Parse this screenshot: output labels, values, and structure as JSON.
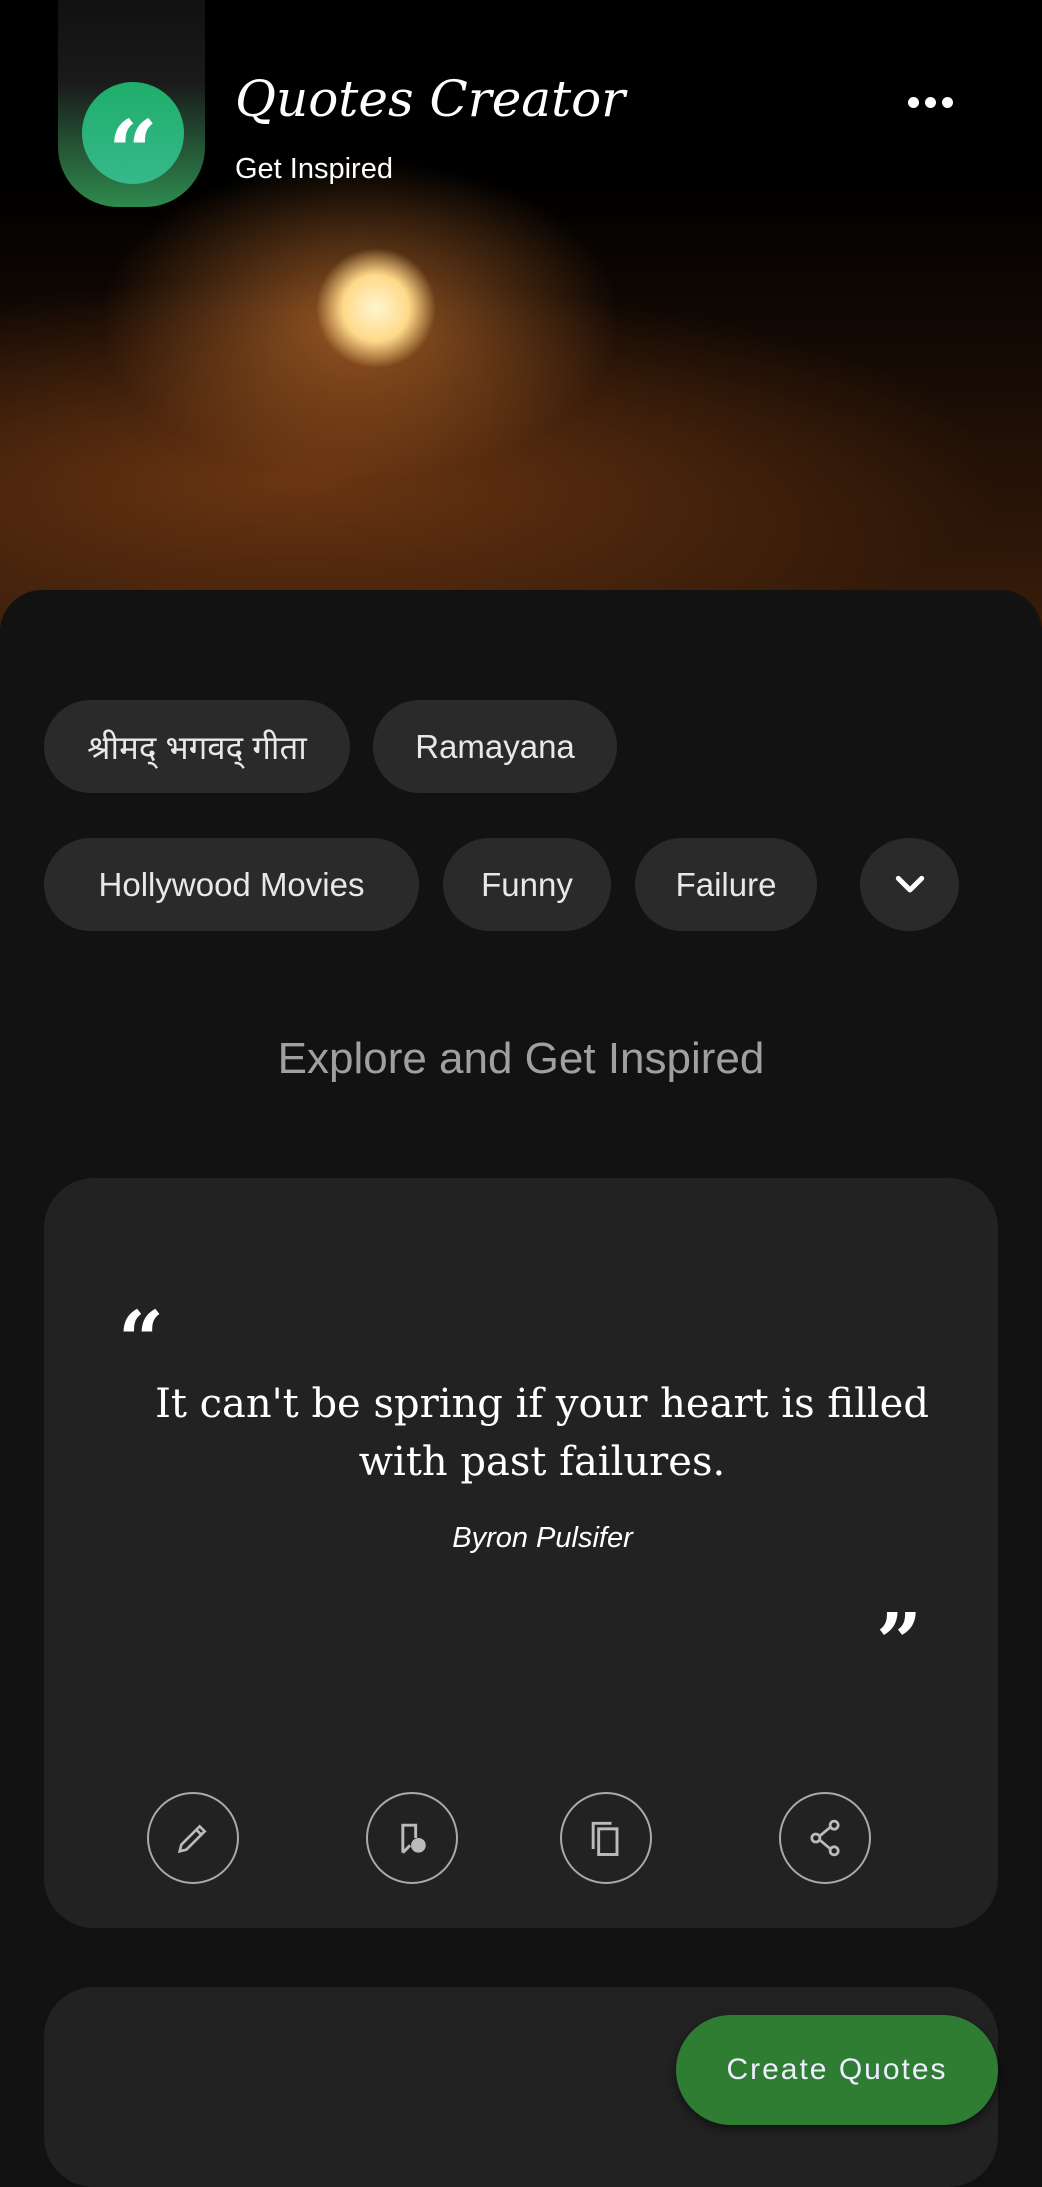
{
  "header": {
    "title": "Quotes Creator",
    "subtitle": "Get Inspired",
    "logo_icon": "quote-icon",
    "menu_icon": "more-horizontal-icon",
    "accent": "#2db380"
  },
  "categories": [
    {
      "label": "श्रीमद् भगवद् गीता"
    },
    {
      "label": "Ramayana"
    },
    {
      "label": "Hollywood Movies"
    },
    {
      "label": "Funny"
    },
    {
      "label": "Failure"
    }
  ],
  "expand_icon": "chevron-down-icon",
  "section_title": "Explore and Get Inspired",
  "quote": {
    "open_mark": "“",
    "close_mark": "”",
    "text": "It can't be spring if your heart is filled with past failures.",
    "author": "Byron Pulsifer",
    "actions": [
      {
        "icon": "edit-icon"
      },
      {
        "icon": "bookmark-add-icon"
      },
      {
        "icon": "copy-icon"
      },
      {
        "icon": "share-icon"
      }
    ]
  },
  "fab": {
    "label": "Create Quotes",
    "color": "#2e7d32"
  }
}
